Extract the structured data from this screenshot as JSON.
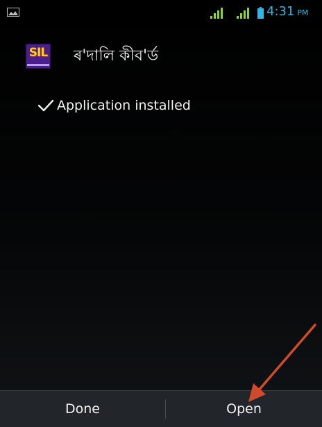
{
  "status_bar": {
    "time": "4:31",
    "ampm": "PM",
    "time_color": "#2fb6e6",
    "signal_color": "#8fd61e",
    "icons": [
      "image-notification-icon",
      "signal-icon",
      "signal-icon",
      "battery-icon"
    ]
  },
  "app": {
    "name": "ৰ'দালি কীব'ৰ্ড",
    "icon_letters": "SIL",
    "icon_color": "#4b1d8e"
  },
  "install": {
    "message": "Application installed"
  },
  "bottom_bar": {
    "done_label": "Done",
    "open_label": "Open"
  },
  "annotation": {
    "arrow_color": "#d04a2c",
    "target": "open-button"
  }
}
